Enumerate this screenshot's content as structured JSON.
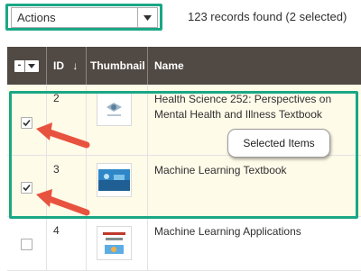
{
  "toolbar": {
    "actions_label": "Actions",
    "records_text": "123 records found (2 selected)"
  },
  "grid": {
    "columns": {
      "mass_select": "-",
      "id": "ID",
      "thumbnail": "Thumbnail",
      "name": "Name"
    },
    "rows": [
      {
        "id": "2",
        "name": "Health Science 252: Perspectives on Mental Health and Illness Textbook",
        "selected": true
      },
      {
        "id": "3",
        "name": "Machine Learning Textbook",
        "selected": true
      },
      {
        "id": "4",
        "name": "Machine Learning Applications",
        "selected": false
      }
    ]
  },
  "annotation": {
    "callout_text": "Selected Items"
  },
  "colors": {
    "header_bg": "#514943",
    "highlight_border": "#1aa785",
    "arrow": "#e8533f",
    "selected_row_bg": "#fffbe9",
    "row_bg": "#ffffff",
    "alt_row_bg": "#f5f5f5"
  },
  "icons": {
    "dropdown": "chevron-down-icon",
    "sort": "arrow-down-icon",
    "check": "checkmark-icon"
  }
}
